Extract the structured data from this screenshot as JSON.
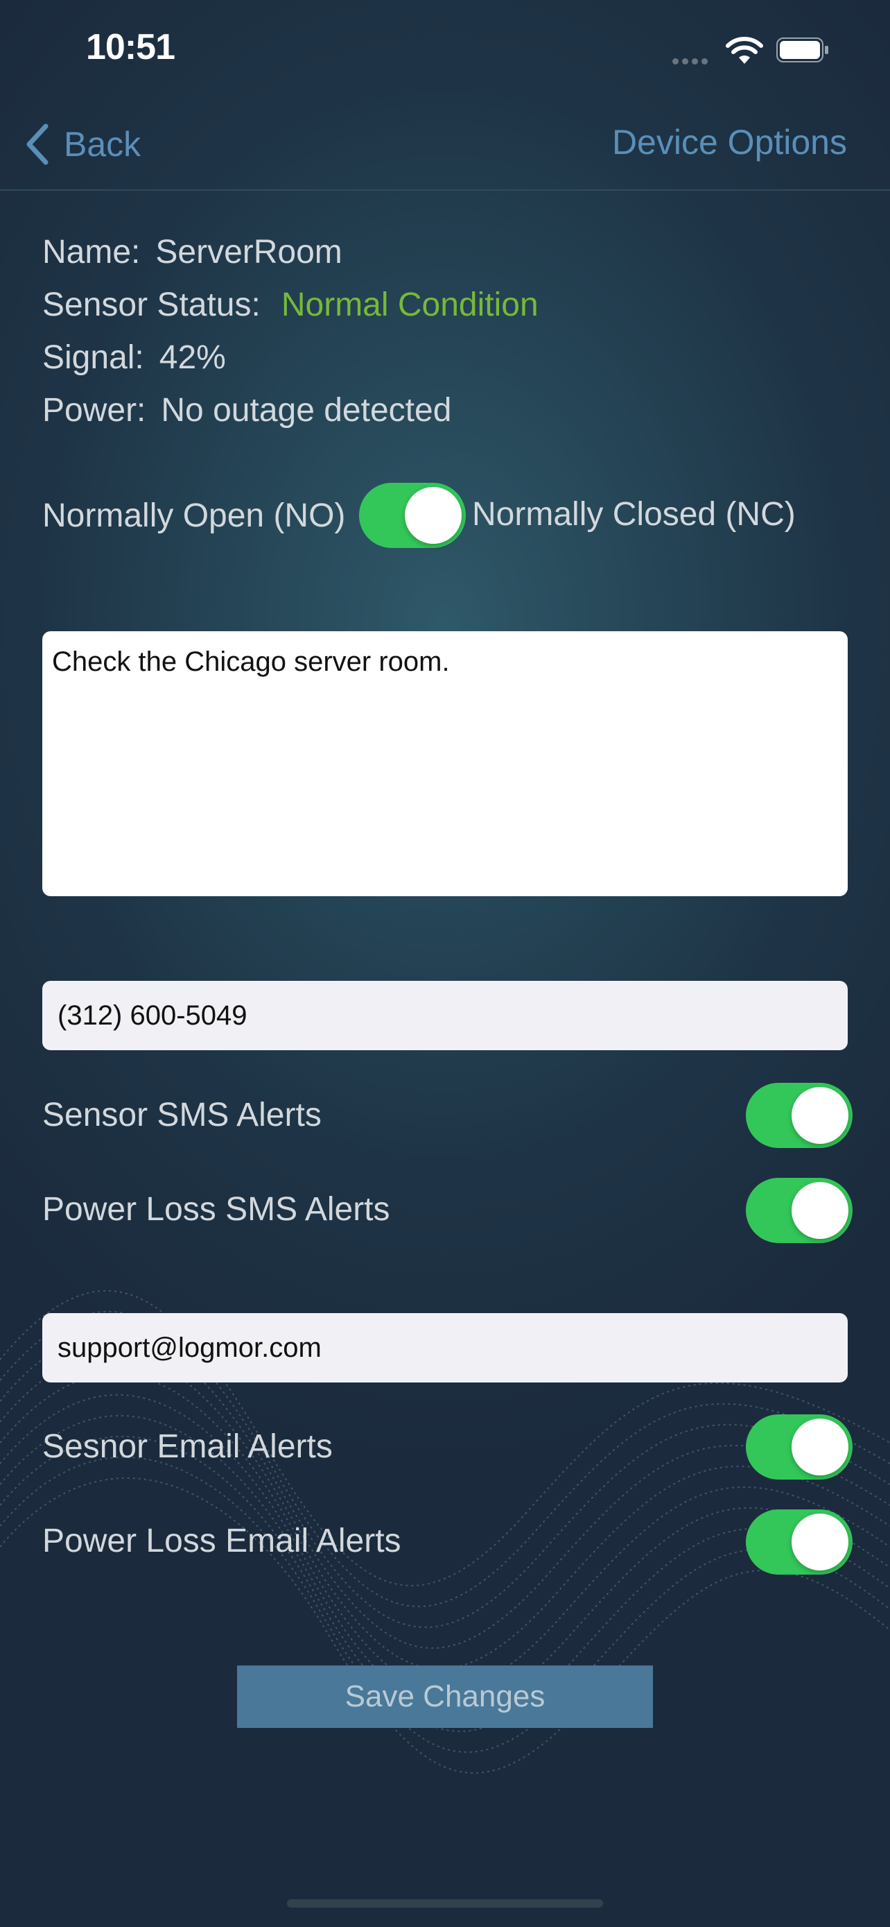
{
  "status_bar": {
    "time": "10:51"
  },
  "nav": {
    "back_label": "Back",
    "options_label": "Device Options"
  },
  "device": {
    "name_label": "Name:",
    "name_value": "ServerRoom",
    "status_label": "Sensor Status:",
    "status_value": "Normal Condition",
    "signal_label": "Signal:",
    "signal_value": "42%",
    "power_label": "Power:",
    "power_value": "No outage detected"
  },
  "contact_mode": {
    "left_label": "Normally Open (NO)",
    "right_label": "Normally Closed (NC)",
    "is_on": true
  },
  "notes": {
    "text": "Check the Chicago server room."
  },
  "sms": {
    "phone": "(312) 600-5049",
    "sensor_alerts_label": "Sensor SMS Alerts",
    "sensor_alerts_on": true,
    "power_alerts_label": "Power Loss SMS Alerts",
    "power_alerts_on": true
  },
  "email": {
    "address": "support@logmor.com",
    "sensor_alerts_label": "Sesnor Email Alerts",
    "sensor_alerts_on": true,
    "power_alerts_label": "Power Loss Email Alerts",
    "power_alerts_on": true
  },
  "save_label": "Save Changes",
  "colors": {
    "accent": "#5a8fb8",
    "switch_on": "#33c759",
    "status_ok": "#77b93a",
    "save_button": "#4a7898"
  }
}
